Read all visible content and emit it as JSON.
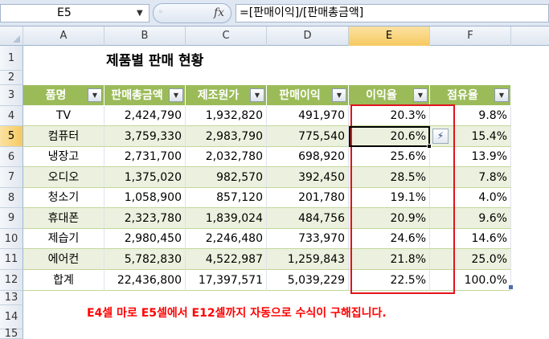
{
  "formula_bar": {
    "name_box": "E5",
    "fx_label": "fx",
    "formula": "=[판매이익]/[판매총금액]"
  },
  "columns": [
    "A",
    "B",
    "C",
    "D",
    "E",
    "F"
  ],
  "rows": [
    "1",
    "2",
    "3",
    "4",
    "5",
    "6",
    "7",
    "8",
    "9",
    "10",
    "11",
    "12",
    "13",
    "14",
    "15"
  ],
  "title": "제품별 판매 현황",
  "table": {
    "headers": [
      "품명",
      "판매총금액",
      "제조원가",
      "판매이익",
      "이익율",
      "점유율"
    ],
    "rows": [
      [
        "TV",
        "2,424,790",
        "1,932,820",
        "491,970",
        "20.3%",
        "9.8%"
      ],
      [
        "컴퓨터",
        "3,759,330",
        "2,983,790",
        "775,540",
        "20.6%",
        "15.4%"
      ],
      [
        "냉장고",
        "2,731,700",
        "2,032,780",
        "698,920",
        "25.6%",
        "13.9%"
      ],
      [
        "오디오",
        "1,375,020",
        "982,570",
        "392,450",
        "28.5%",
        "7.8%"
      ],
      [
        "청소기",
        "1,058,900",
        "857,120",
        "201,780",
        "19.1%",
        "4.0%"
      ],
      [
        "휴대폰",
        "2,323,780",
        "1,839,024",
        "484,756",
        "20.9%",
        "9.6%"
      ],
      [
        "제습기",
        "2,980,450",
        "2,246,480",
        "733,970",
        "24.6%",
        "14.6%"
      ],
      [
        "에어컨",
        "5,782,830",
        "4,522,987",
        "1,259,843",
        "21.8%",
        "25.0%"
      ],
      [
        "합계",
        "22,436,800",
        "17,397,571",
        "5,039,229",
        "22.5%",
        "100.0%"
      ]
    ]
  },
  "note": "E4셀 마로 E5셀에서 E12셀까지 자동으로 수식이 구해집니다.",
  "selected_cell": "E5",
  "icons": {
    "filter": "filter-dropdown-icon",
    "autofill": "autofill-options-icon",
    "fx": "function-icon"
  },
  "colors": {
    "table_header": "#9bbb59",
    "table_band": "#ebf1de",
    "highlight_box": "#e0141b",
    "note_text": "#ff0000"
  }
}
